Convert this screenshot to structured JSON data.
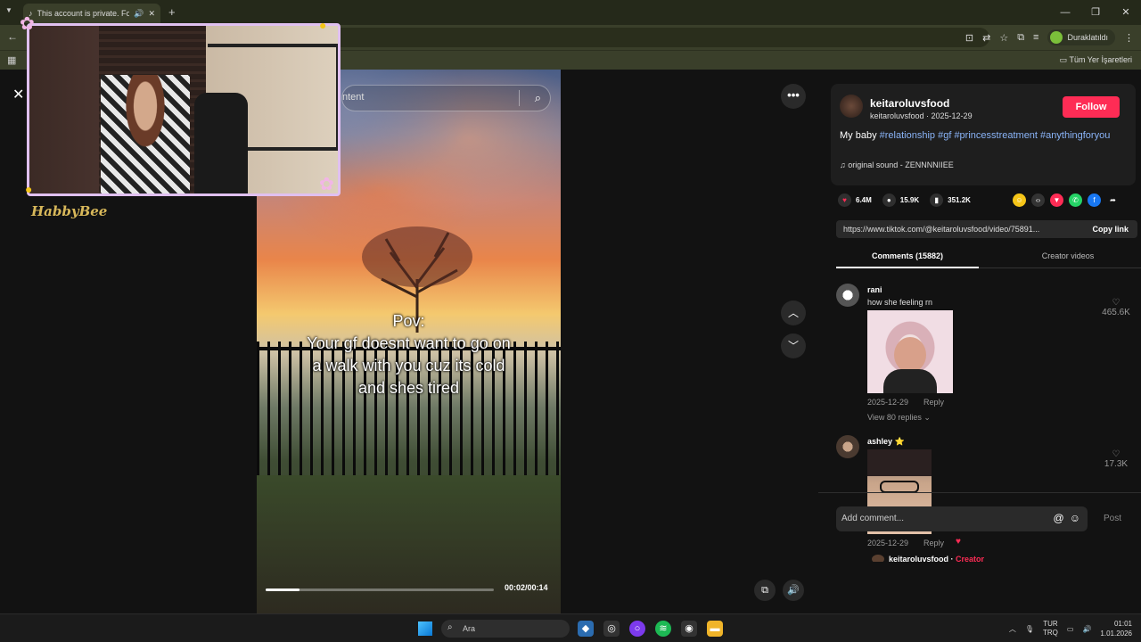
{
  "browser": {
    "tab_title": "This account is private. Follo",
    "paused_label": "Duraklatıldı",
    "bookmarks_label": "Tüm Yer İşaretleri"
  },
  "video": {
    "search_placeholder": "ntent",
    "caption": [
      "Pov:",
      "Your gf doesnt want to go on",
      "a walk with you cuz its cold",
      "and shes tired"
    ],
    "time": "00:02/00:14",
    "progress": 0.15
  },
  "overlay": {
    "streamer_name": "HabbyBee"
  },
  "post": {
    "username": "keitaroluvsfood",
    "subline": "keitaroluvsfood · 2025-12-29",
    "follow_label": "Follow",
    "desc_text": "My baby ",
    "hashtags": [
      "#relationship",
      "#gf",
      "#princesstreatment",
      "#anythingforyou"
    ],
    "sound": "original sound - ZENNNNIIEE",
    "likes": "6.4M",
    "comments": "15.9K",
    "saves": "351.2K",
    "link": "https://www.tiktok.com/@keitaroluvsfood/video/75891...",
    "copy_label": "Copy link",
    "tab_comments": "Comments (15882)",
    "tab_creator": "Creator videos"
  },
  "comments": [
    {
      "name": "rani",
      "text": "how she feeling rn",
      "date": "2025-12-29",
      "reply": "Reply",
      "likes": "465.6K",
      "views": "View 80 replies"
    },
    {
      "name": "ashley ⭐",
      "text": "",
      "date": "2025-12-29",
      "reply": "Reply",
      "likes": "17.3K",
      "reply_author": "keitaroluvsfood",
      "reply_tag": "Creator"
    }
  ],
  "composer": {
    "placeholder": "Add comment...",
    "post_label": "Post"
  },
  "taskbar": {
    "search_label": "Ara",
    "lang_top": "TUR",
    "lang_bottom": "TRQ",
    "time": "01:01",
    "date": "1.01.2026"
  },
  "colors": {
    "accent": "#fe2c55",
    "hashtag": "#8ab4f8"
  }
}
